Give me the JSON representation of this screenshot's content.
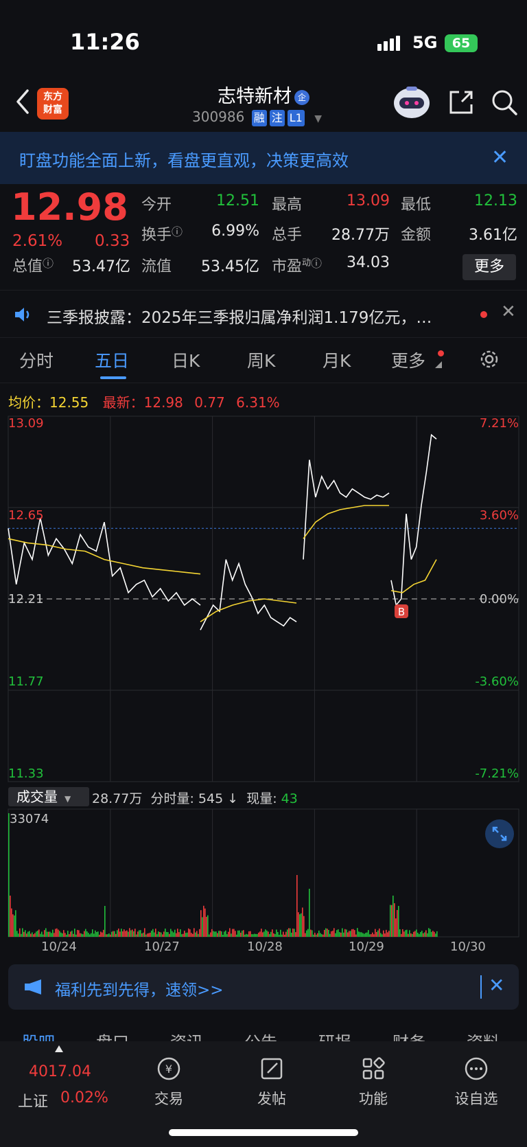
{
  "status_bar": {
    "time": "11:26",
    "network": "5G",
    "battery": "65"
  },
  "header": {
    "logo_line1": "东方",
    "logo_line2": "财富",
    "stock_name": "志特新材",
    "qi_badge": "企",
    "stock_code": "300986",
    "tags": [
      "融",
      "注",
      "L1"
    ]
  },
  "banner": {
    "text": "盯盘功能全面上新，看盘更直观，决策更高效",
    "close": "✕"
  },
  "quote": {
    "price": "12.98",
    "change_pct": "2.61%",
    "change_val": "0.33",
    "fields": [
      {
        "label": "今开",
        "value": "12.51",
        "color": "#21c03b"
      },
      {
        "label": "最高",
        "value": "13.09",
        "color": "#f03c3c"
      },
      {
        "label": "最低",
        "value": "12.13",
        "color": "#21c03b"
      },
      {
        "label": "换手",
        "value": "6.99%",
        "color": "#e8e8e8"
      },
      {
        "label": "总手",
        "value": "28.77万",
        "color": "#e8e8e8"
      },
      {
        "label": "金额",
        "value": "3.61亿",
        "color": "#e8e8e8"
      },
      {
        "label": "总值",
        "value": "53.47亿",
        "color": "#e8e8e8"
      },
      {
        "label": "流值",
        "value": "53.45亿",
        "color": "#e8e8e8"
      },
      {
        "label": "市盈",
        "value": "34.03",
        "color": "#e8e8e8"
      }
    ],
    "pe_sup": "动",
    "more": "更多"
  },
  "news": {
    "text": "三季报披露：2025年三季报归属净利润1.179亿元，…",
    "close": "✕"
  },
  "tabs": [
    "分时",
    "五日",
    "日K",
    "周K",
    "月K",
    "更多"
  ],
  "active_tab": "五日",
  "chart_header": {
    "avg_label": "均价：",
    "avg_value": "12.55",
    "latest_label": "最新：",
    "latest_value": "12.98",
    "change": "0.77",
    "pct": "6.31%"
  },
  "chart_data": {
    "type": "line",
    "title": "",
    "x": [
      "10/24",
      "10/27",
      "10/28",
      "10/29",
      "10/30"
    ],
    "price_ticks": [
      "13.09",
      "12.65",
      "12.21",
      "11.77",
      "11.33"
    ],
    "pct_ticks": [
      "7.21%",
      "3.60%",
      "0.00%",
      "-3.60%",
      "-7.21%"
    ],
    "ylim": [
      11.33,
      13.09
    ],
    "prev_close": 12.21,
    "series": [],
    "marker": "B",
    "colors": {
      "price": "#ffffff",
      "avg": "#f5d533",
      "up": "#f03c3c",
      "down": "#21c03b"
    }
  },
  "volume": {
    "label": "成交量",
    "total": "28.77万",
    "period_label": "分时量:",
    "period_value": "545 ↓",
    "current_label": "现量:",
    "current_value": "43",
    "max": "33074"
  },
  "promo": {
    "text": "福利先到先得，速领>>",
    "close": "✕"
  },
  "subtabs": [
    "股吧",
    "盘口",
    "资讯",
    "公告",
    "研报",
    "财务",
    "资料"
  ],
  "bottom_nav": {
    "index_value": "4017.04",
    "index_name": "上证",
    "index_pct": "0.02%",
    "items": [
      "交易",
      "发帖",
      "功能",
      "设自选"
    ]
  }
}
